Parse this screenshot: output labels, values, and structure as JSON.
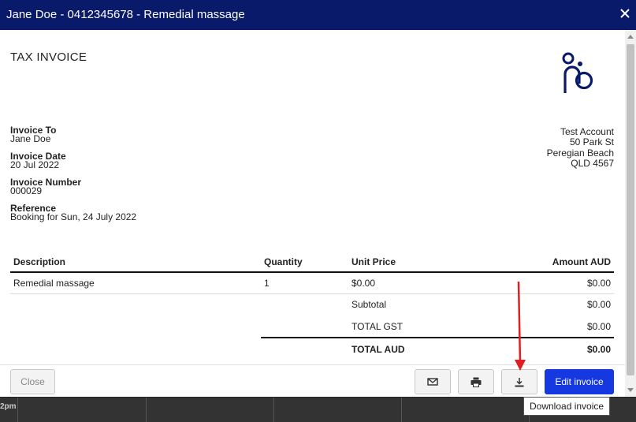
{
  "window": {
    "title": "Jane Doe - 0412345678 - Remedial massage"
  },
  "invoice": {
    "doc_title": "TAX INVOICE",
    "invoice_to_label": "Invoice To",
    "invoice_to": "Jane Doe",
    "invoice_date_label": "Invoice Date",
    "invoice_date": "20 Jul 2022",
    "invoice_number_label": "Invoice Number",
    "invoice_number": "000029",
    "reference_label": "Reference",
    "reference": "Booking for Sun, 24 July 2022",
    "business": {
      "name": "Test Account",
      "street": "50 Park St",
      "suburb": "Peregian Beach",
      "state_postcode": "QLD 4567"
    },
    "columns": {
      "description": "Description",
      "quantity": "Quantity",
      "unit_price": "Unit Price",
      "amount": "Amount AUD"
    },
    "items": [
      {
        "description": "Remedial massage",
        "quantity": "1",
        "unit_price": "$0.00",
        "amount": "$0.00"
      }
    ],
    "subtotal_label": "Subtotal",
    "subtotal": "$0.00",
    "gst_label": "TOTAL GST",
    "gst": "$0.00",
    "total_label": "TOTAL AUD",
    "total": "$0.00"
  },
  "footer": {
    "close_label": "Close",
    "email_icon": "envelope-icon",
    "print_icon": "printer-icon",
    "download_icon": "download-icon",
    "edit_label": "Edit invoice"
  },
  "tooltip": {
    "text": "Download invoice"
  },
  "background": {
    "time_label": "2pm"
  },
  "colors": {
    "header_bg": "#0a1a6b",
    "primary_button": "#1538e0",
    "logo": "#0a1a6b",
    "annotation_arrow": "#e02020"
  }
}
